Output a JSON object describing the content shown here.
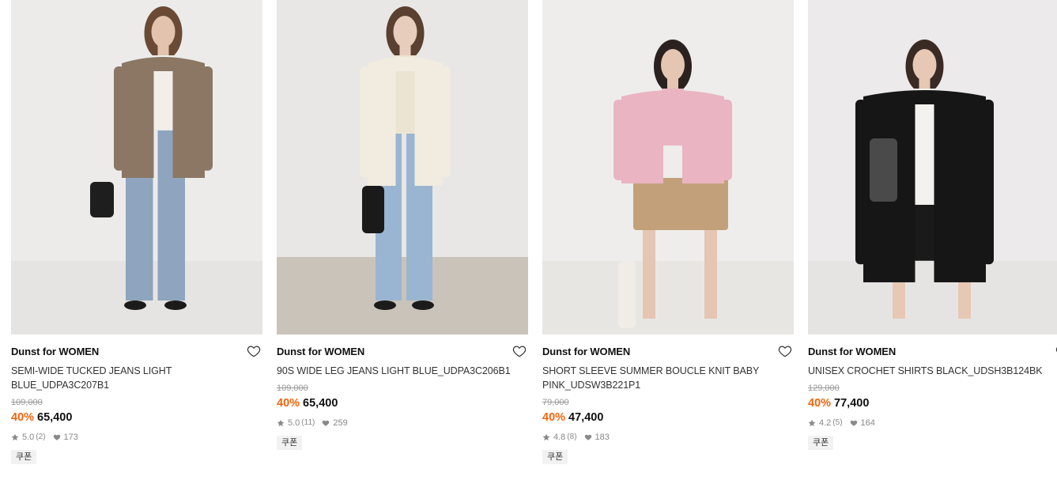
{
  "products": [
    {
      "brand": "Dunst for WOMEN",
      "name": "SEMI-WIDE TUCKED JEANS LIGHT BLUE_UDPA3C207B1",
      "original_price": "109,000",
      "discount": "40%",
      "price": "65,400",
      "rating": "5.0",
      "review_count": "(2)",
      "likes": "173",
      "coupon": "쿠폰",
      "colors": {
        "bg": "#ecebea",
        "floor": "#e6e4e2",
        "top": "#8b7764",
        "inner": "#f2efe9",
        "pants": "#8ea4bf",
        "skin": "#e3c3ae",
        "hair": "#6b4a35",
        "accessory": "#1e1e1e"
      }
    },
    {
      "brand": "Dunst for WOMEN",
      "name": "90S WIDE LEG JEANS LIGHT BLUE_UDPA3C206B1",
      "original_price": "109,000",
      "discount": "40%",
      "price": "65,400",
      "rating": "5.0",
      "review_count": "(11)",
      "likes": "259",
      "coupon": "쿠폰",
      "colors": {
        "bg": "#e8e7e5",
        "floor": "#c9c3ba",
        "top": "#f1ecdf",
        "inner": "#ebe4d3",
        "pants": "#9ab5d1",
        "skin": "#e7cdbb",
        "hair": "#5a4030",
        "accessory": "#1a1a1a"
      }
    },
    {
      "brand": "Dunst for WOMEN",
      "name": "SHORT SLEEVE SUMMER BOUCLE KNIT BABY PINK_UDSW3B221P1",
      "original_price": "79,000",
      "discount": "40%",
      "price": "47,400",
      "rating": "4.8",
      "review_count": "(8)",
      "likes": "183",
      "coupon": "쿠폰",
      "colors": {
        "bg": "#eeedeb",
        "floor": "#e8e6e3",
        "top": "#eab4c2",
        "inner": "#eab4c2",
        "pants": "#c2a17a",
        "skin": "#e5c6b2",
        "hair": "#2b2220",
        "accessory": "#f1ede6"
      }
    },
    {
      "brand": "Dunst for WOMEN",
      "name": "UNISEX CROCHET SHIRTS BLACK_UDSH3B124BK",
      "original_price": "129,000",
      "discount": "40%",
      "price": "77,400",
      "rating": "4.2",
      "review_count": "(5)",
      "likes": "164",
      "coupon": "쿠폰",
      "colors": {
        "bg": "#eceaea",
        "floor": "#e6e4e3",
        "top": "#161616",
        "inner": "#f4f2ee",
        "pants": "#1a1a1a",
        "skin": "#e6c8b5",
        "hair": "#3a2a24",
        "accessory": "#4a4a4a"
      }
    }
  ]
}
